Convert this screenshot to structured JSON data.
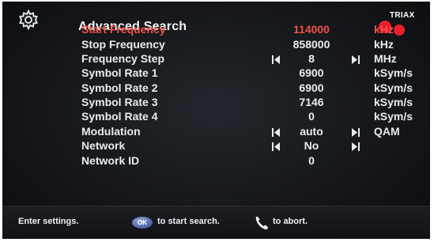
{
  "header": {
    "title": "Advanced Search",
    "brand": "TRIAX",
    "icon": "gear-icon"
  },
  "settings": [
    {
      "label": "Start Frequency",
      "value": "114000",
      "unit": "kHz",
      "active": true,
      "arrows": false
    },
    {
      "label": "Stop Frequency",
      "value": "858000",
      "unit": "kHz",
      "active": false,
      "arrows": false
    },
    {
      "label": "Frequency Step",
      "value": "8",
      "unit": "MHz",
      "active": false,
      "arrows": true
    },
    {
      "label": "Symbol Rate 1",
      "value": "6900",
      "unit": "kSym/s",
      "active": false,
      "arrows": false
    },
    {
      "label": "Symbol Rate 2",
      "value": "6900",
      "unit": "kSym/s",
      "active": false,
      "arrows": false
    },
    {
      "label": "Symbol Rate 3",
      "value": "7146",
      "unit": "kSym/s",
      "active": false,
      "arrows": false
    },
    {
      "label": "Symbol Rate 4",
      "value": "0",
      "unit": "kSym/s",
      "active": false,
      "arrows": false
    },
    {
      "label": "Modulation",
      "value": "auto",
      "unit": "QAM",
      "active": false,
      "arrows": true
    },
    {
      "label": "Network",
      "value": "No",
      "unit": "",
      "active": false,
      "arrows": true
    },
    {
      "label": "Network ID",
      "value": "0",
      "unit": "",
      "active": false,
      "arrows": false
    }
  ],
  "footer": {
    "enter_text": "Enter settings.",
    "ok_label": "OK",
    "start_text": "to start search.",
    "abort_text": "to abort.",
    "ok_icon": "ok-button-icon",
    "abort_icon": "phone-handset-icon"
  },
  "colors": {
    "active": "#f2514a",
    "text": "#e9ecf2",
    "background": "#15171b",
    "brand_red": "#e8202a"
  }
}
